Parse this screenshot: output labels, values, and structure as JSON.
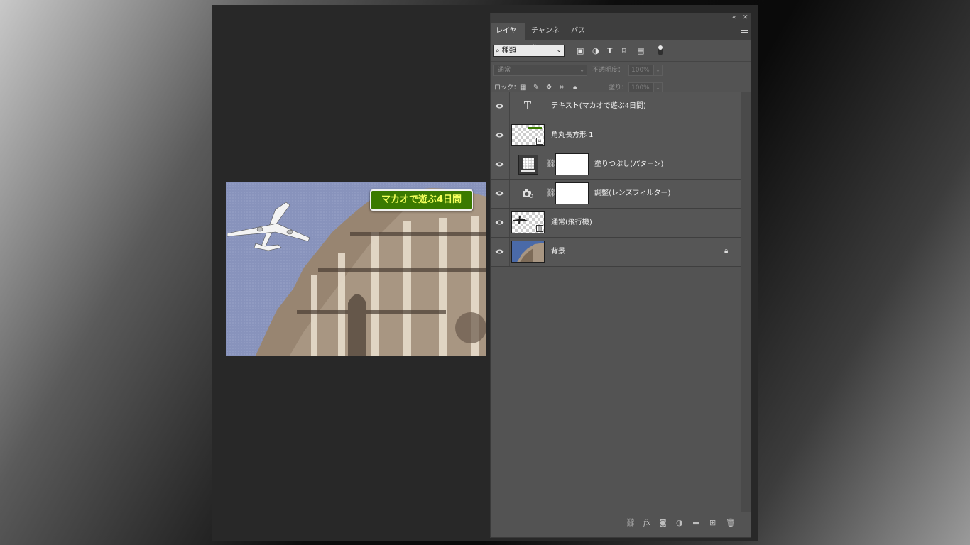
{
  "canvas": {
    "banner_text": "マカオで遊ぶ4日間",
    "banner_colors": {
      "fill": "#3a7a00",
      "text": "#f3ff5c",
      "border": "#f2f2f2"
    }
  },
  "panel": {
    "collapse_icon": "«",
    "close_icon": "✕",
    "tabs": [
      {
        "label": "レイヤー",
        "active": true
      },
      {
        "label": "チャンネル",
        "active": false
      },
      {
        "label": "パス",
        "active": false
      }
    ],
    "filter": {
      "kind_label": "種類",
      "search_glyph": "⌕",
      "chevron": "⌄",
      "icons": [
        "image-filter-icon",
        "adjustment-filter-icon",
        "type-filter-icon",
        "shape-filter-icon",
        "smart-object-filter-icon"
      ]
    },
    "blend": {
      "mode": "通常",
      "opacity_label": "不透明度：",
      "opacity_value": "100%",
      "fill_label": "塗り：",
      "fill_value": "100%"
    },
    "lock": {
      "label": "ロック："
    },
    "layers": [
      {
        "name": "テキスト(マカオで遊ぶ4日間)",
        "type": "text",
        "visible": true,
        "glyph": "T"
      },
      {
        "name": "角丸長方形 1",
        "type": "shape",
        "visible": true
      },
      {
        "name": "塗りつぶし(パターン)",
        "type": "fill",
        "visible": true
      },
      {
        "name": "調整(レンズフィルター)",
        "type": "adjustment",
        "visible": true
      },
      {
        "name": "通常(飛行機)",
        "type": "smart-object",
        "visible": true
      },
      {
        "name": "背景",
        "type": "background",
        "visible": true,
        "locked": true
      }
    ],
    "footer_icons": [
      "link-layers-icon",
      "fx-icon",
      "mask-icon",
      "new-adjustment-icon",
      "group-icon",
      "new-layer-icon",
      "trash-icon"
    ],
    "fx_label": "fx"
  }
}
